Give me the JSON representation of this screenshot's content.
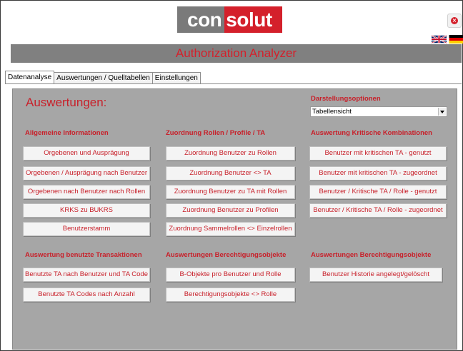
{
  "header": {
    "logo_part1": "con",
    "logo_part2": "solut",
    "app_title": "Authorization Analyzer"
  },
  "tabs": [
    "Datenanalyse",
    "Auswertungen / Quelltabellen",
    "Einstellungen"
  ],
  "main": {
    "heading": "Auswertungen:",
    "options_label": "Darstellungsoptionen",
    "view_select_value": "Tabellensicht"
  },
  "sections": {
    "general_info": {
      "title": "Allgemeine Informationen",
      "buttons": [
        "Orgebenen und Ausprägung",
        "Orgebenen / Ausprägung nach Benutzer",
        "Orgebenen nach Benutzer nach Rollen",
        "KRKS zu BUKRS",
        "Benutzerstamm"
      ]
    },
    "role_assign": {
      "title": "Zuordnung Rollen / Profile / TA",
      "buttons": [
        "Zuordnung Benutzer zu Rollen",
        "Zuordnung Benutzer <> TA",
        "Zuordnung Benutzer zu TA mit Rollen",
        "Zuordnung Benutzer zu Profilen",
        "Zuordnung Sammelrollen <> Einzelrollen"
      ]
    },
    "critical": {
      "title": "Auswertung Kritische Kombinationen",
      "buttons": [
        "Benutzer mit kritischen TA - genutzt",
        "Benutzer mit kritischen TA - zugeordnet",
        "Benutzer / Kritische TA / Rolle - genutzt",
        "Benutzer / Kritische TA / Rolle - zugeordnet"
      ]
    },
    "used_tx": {
      "title": "Auswertung benutzte Transaktionen",
      "buttons": [
        "Benutzte TA nach Benutzer und TA Code",
        "Benutzte TA Codes nach Anzahl"
      ]
    },
    "auth_objects": {
      "title": "Auswertungen Berechtigungsobjekte",
      "buttons": [
        "B-Objekte pro Benutzer und Rolle",
        "Berechtigungsobjekte <> Rolle"
      ]
    },
    "auth_objects_2": {
      "title": "Auswertungen Berechtigungsobjekte",
      "buttons": [
        "Benutzer Historie angelegt/gelöscht"
      ]
    }
  },
  "colors": {
    "accent_red": "#c8202a",
    "panel_gray": "#a6a6a6",
    "title_bar_gray": "#808080"
  }
}
